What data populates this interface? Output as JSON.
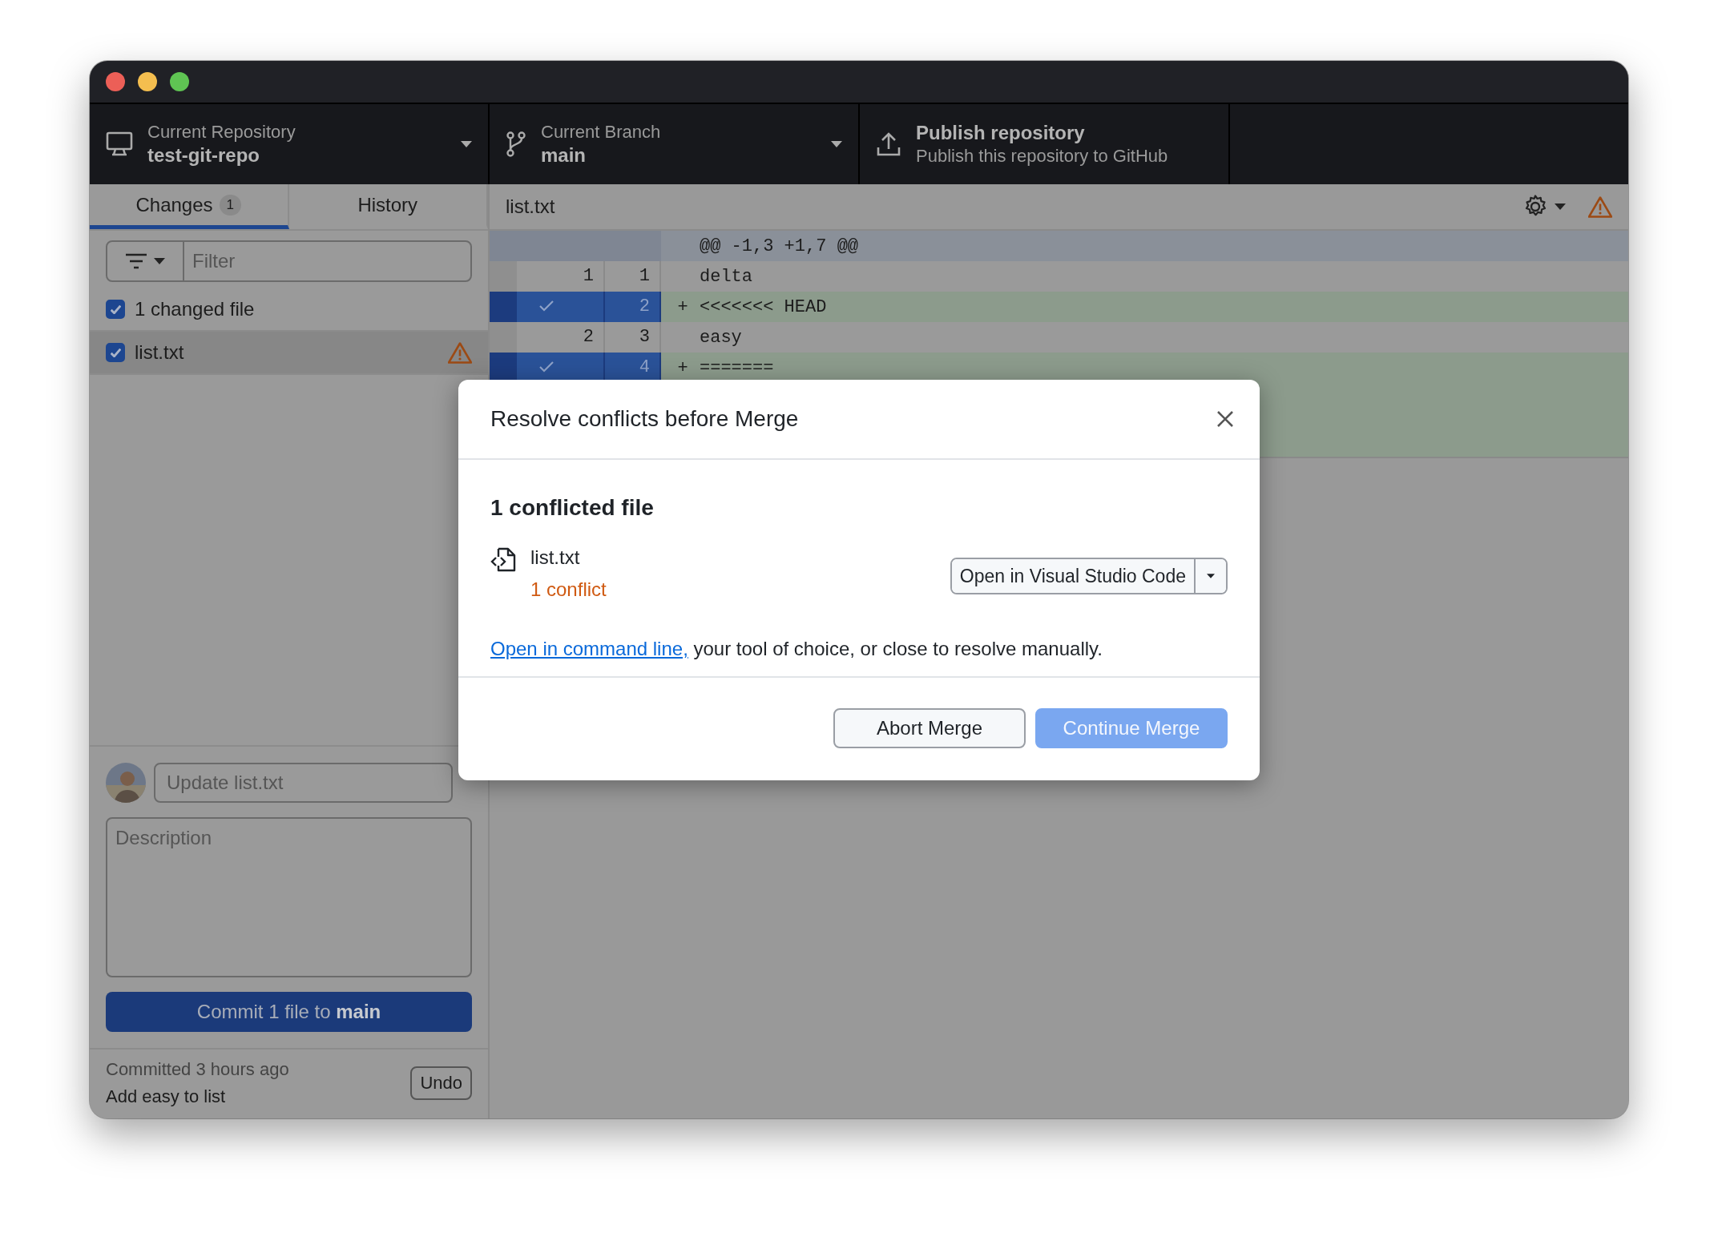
{
  "toolbar": {
    "repository": {
      "label": "Current Repository",
      "value": "test-git-repo"
    },
    "branch": {
      "label": "Current Branch",
      "value": "main"
    },
    "publish": {
      "title": "Publish repository",
      "subtitle": "Publish this repository to GitHub"
    }
  },
  "tabs": [
    {
      "label": "Changes",
      "badge": "1",
      "selected": true
    },
    {
      "label": "History",
      "selected": false
    }
  ],
  "filter": {
    "placeholder": "Filter"
  },
  "changes": {
    "all_checked": true,
    "summary": "1 changed file"
  },
  "files": [
    {
      "name": "list.txt",
      "checked": true,
      "selected": true,
      "conflict": true
    }
  ],
  "commit": {
    "summary_placeholder": "Update list.txt",
    "description_placeholder": "Description",
    "button": "Commit 1 file to **main**"
  },
  "last_commit": {
    "status": "Committed 3 hours ago",
    "message": "Add easy to list",
    "undo": "Undo"
  },
  "diff": {
    "file": "list.txt",
    "hunk": "@@ -1,3 +1,7 @@",
    "lines": [
      {
        "kind": "context",
        "old": "1",
        "new": "1",
        "text": "delta"
      },
      {
        "kind": "added",
        "new": "2",
        "sign": "+",
        "text": "<<<<<<< HEAD",
        "selected": true
      },
      {
        "kind": "context",
        "old": "2",
        "new": "3",
        "text": "easy"
      },
      {
        "kind": "added",
        "new": "4",
        "sign": "+",
        "text": "=======",
        "selected": true
      }
    ]
  },
  "dialog": {
    "title": "Resolve conflicts before Merge",
    "heading": "1 conflicted file",
    "files": [
      {
        "name": "list.txt",
        "conflicts": "1 conflict"
      }
    ],
    "open_button": "Open in Visual Studio Code",
    "note_link": "Open in command line,",
    "note_text": "your tool of choice, or close to resolve manually.",
    "buttons": [
      {
        "label": "Abort Merge",
        "kind": "secondary",
        "disabled": false
      },
      {
        "label": "Continue Merge",
        "kind": "primary",
        "disabled": true
      }
    ]
  }
}
